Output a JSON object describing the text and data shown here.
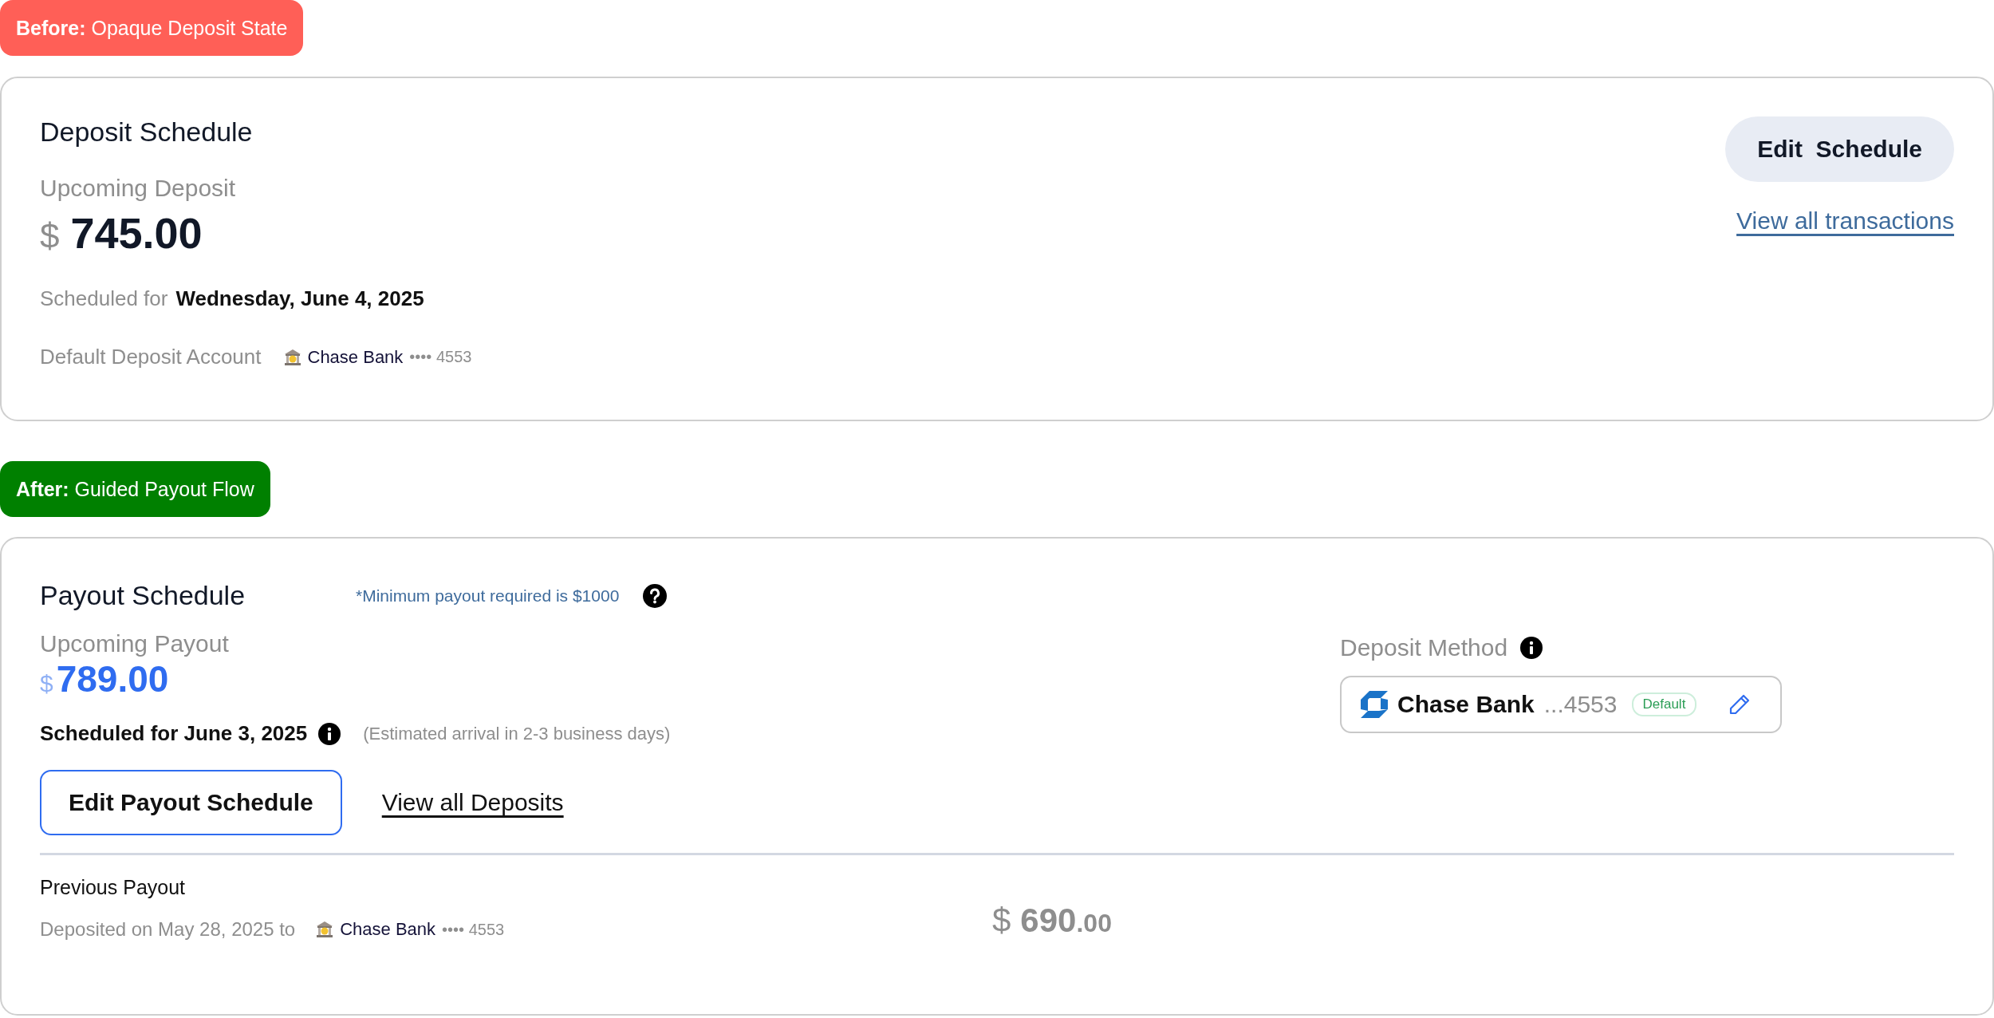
{
  "before_badge": {
    "text": "**Before:** Opaque Deposit State"
  },
  "deposit_card": {
    "title": "Deposit Schedule",
    "upcoming_label": "Upcoming Deposit",
    "currency": "$",
    "amount": "745.00",
    "scheduled_prefix": "Scheduled for",
    "scheduled_date": "Wednesday, June 4, 2025",
    "account_label": "Default Deposit Account",
    "account_bank": "Chase Bank",
    "account_mask": "•••• 4553",
    "edit_button": "Edit  Schedule",
    "transactions_link": "View all transactions"
  },
  "after_badge": {
    "text": "**After:** Guided Payout Flow"
  },
  "payout_card": {
    "title": "Payout Schedule",
    "minimum_note": "*Minimum payout required is $1000",
    "upcoming_label": "Upcoming Payout",
    "currency": "$",
    "amount": "789.00",
    "scheduled": "Scheduled for June 3, 2025",
    "arrival_note": "(Estimated arrival in 2-3 business days)",
    "edit_button": "Edit Payout Schedule",
    "deposits_link": "View all Deposits",
    "deposit_method": {
      "label": "Deposit Method",
      "bank": "Chase Bank",
      "mask": "...4553",
      "default_badge": "Default"
    },
    "previous": {
      "title": "Previous Payout",
      "deposited": "Deposited on May 28, 2025 to",
      "bank": "Chase Bank",
      "mask": "•••• 4553",
      "currency": "$",
      "whole": "690",
      "cents": ".00"
    }
  }
}
